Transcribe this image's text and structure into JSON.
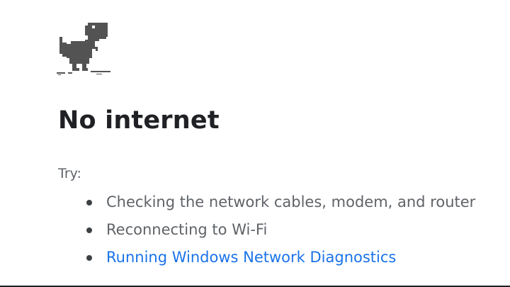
{
  "error": {
    "illustration": "offline-dino-icon",
    "title": "No internet"
  },
  "help": {
    "try_label": "Try:",
    "suggestions": [
      {
        "text": "Checking the network cables, modem, and router",
        "is_link": false
      },
      {
        "text": "Reconnecting to Wi-Fi",
        "is_link": false
      },
      {
        "text": "Running Windows Network Diagnostics",
        "is_link": true
      }
    ]
  },
  "colors": {
    "text_primary": "#202124",
    "text_secondary": "#5f6368",
    "link": "#1a73e8",
    "dino": "#535353"
  }
}
